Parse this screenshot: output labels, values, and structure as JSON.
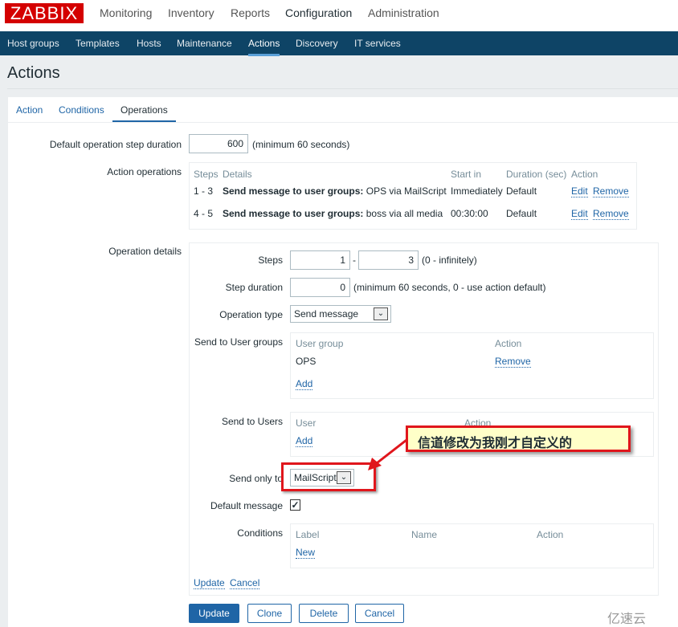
{
  "logo": "ZABBIX",
  "main_menu": [
    "Monitoring",
    "Inventory",
    "Reports",
    "Configuration",
    "Administration"
  ],
  "sub_menu": [
    "Host groups",
    "Templates",
    "Hosts",
    "Maintenance",
    "Actions",
    "Discovery",
    "IT services"
  ],
  "page_title": "Actions",
  "tabs": [
    "Action",
    "Conditions",
    "Operations"
  ],
  "default_step": {
    "label": "Default operation step duration",
    "value": "600",
    "hint": "(minimum 60 seconds)"
  },
  "action_operations": {
    "label": "Action operations",
    "headers": [
      "Steps",
      "Details",
      "Start in",
      "Duration (sec)",
      "Action"
    ],
    "rows": [
      {
        "steps": "1 - 3",
        "detail_bold": "Send message to user groups:",
        "detail": "OPS via MailScript",
        "start": "Immediately",
        "duration": "Default",
        "edit": "Edit",
        "remove": "Remove"
      },
      {
        "steps": "4 - 5",
        "detail_bold": "Send message to user groups:",
        "detail": "boss via all media",
        "start": "00:30:00",
        "duration": "Default",
        "edit": "Edit",
        "remove": "Remove"
      }
    ]
  },
  "operation_details": {
    "label": "Operation details",
    "steps": {
      "label": "Steps",
      "from": "1",
      "sep": "-",
      "to": "3",
      "hint": "(0 - infinitely)"
    },
    "step_duration": {
      "label": "Step duration",
      "value": "0",
      "hint": "(minimum 60 seconds, 0 - use action default)"
    },
    "operation_type": {
      "label": "Operation type",
      "value": "Send message"
    },
    "user_groups": {
      "label": "Send to User groups",
      "headers": [
        "User group",
        "Action"
      ],
      "rows": [
        {
          "name": "OPS",
          "action": "Remove"
        }
      ],
      "add": "Add"
    },
    "users": {
      "label": "Send to Users",
      "headers": [
        "User",
        "Action"
      ],
      "add": "Add"
    },
    "send_only_to": {
      "label": "Send only to",
      "value": "MailScript"
    },
    "default_message": {
      "label": "Default message",
      "checked": true,
      "mark": "✓"
    },
    "conditions": {
      "label": "Conditions",
      "headers": [
        "Label",
        "Name",
        "Action"
      ],
      "new": "New"
    },
    "update": "Update",
    "cancel": "Cancel"
  },
  "buttons": {
    "update": "Update",
    "clone": "Clone",
    "delete": "Delete",
    "cancel": "Cancel"
  },
  "annotation": "信道修改为我刚才自定义的",
  "watermark": "亿速云"
}
